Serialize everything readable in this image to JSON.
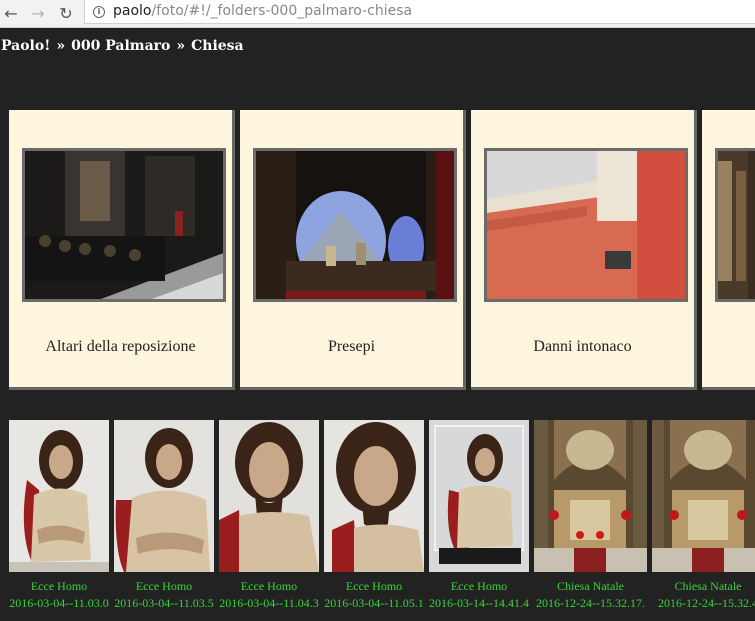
{
  "browser": {
    "url_host": "paolo",
    "url_path": "/foto/#!/_folders-000_palmaro-chiesa"
  },
  "breadcrumb": [
    "Paolo!",
    "000 Palmaro",
    "Chiesa"
  ],
  "breadcrumb_sep": "»",
  "folders": [
    {
      "label": "Altari della reposizione"
    },
    {
      "label": "Presepi"
    },
    {
      "label": "Danni intonaco"
    },
    {
      "label": ""
    }
  ],
  "photos": [
    {
      "title": "Ecce Homo",
      "date": "2016-03-04--11.03.0"
    },
    {
      "title": "Ecce Homo",
      "date": "2016-03-04--11.03.5"
    },
    {
      "title": "Ecce Homo",
      "date": "2016-03-04--11.04.3"
    },
    {
      "title": "Ecce Homo",
      "date": "2016-03-04--11.05.1"
    },
    {
      "title": "Ecce Homo",
      "date": "2016-03-14--14.41.4"
    },
    {
      "title": "Chiesa Natale",
      "date": "2016-12-24--15.32.17."
    },
    {
      "title": "Chiesa Natale",
      "date": "2016-12-24--15.32.4"
    }
  ]
}
